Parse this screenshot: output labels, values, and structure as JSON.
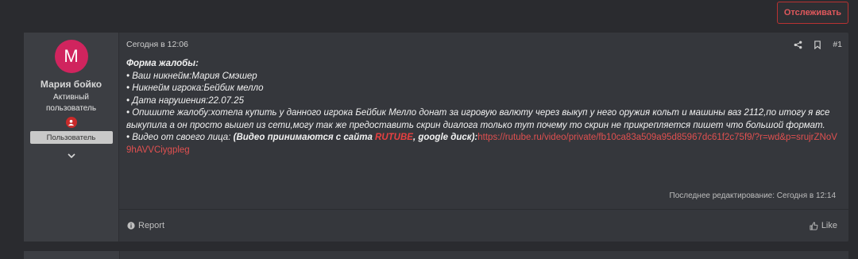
{
  "header": {
    "follow_label": "Отслеживать"
  },
  "user": {
    "avatar_letter": "М",
    "name": "Мария бойко",
    "title": "Активный пользователь",
    "banner": "Пользователь"
  },
  "post": {
    "date": "Сегодня в 12:06",
    "number": "#1",
    "lines": {
      "l1": "Форма жалобы:",
      "l2": "• Ваш никнейм:Мария Смэшер",
      "l3": "• Никнейм игрока:Бейбик мелло",
      "l4": "• Дата нарушения:22.07.25",
      "l5": "• Опишите жалобу:хотела купить у данного игрока Бейбик Мелло донат за игровую валюту через выкуп у него оружия кольт и машины ваз 2112,по итогу я все выкупила а он просто вышел из сети,могу так же предоставить скрин диалога только тут почему то скрин не прикрепляется пишет что большой формат.",
      "l6_prefix": "• Видео от своего лица: ",
      "l6_bold_a": "(Видео принимаются с сайта ",
      "l6_rutube": "RUTUBE",
      "l6_bold_b": ", google диск):",
      "l6_link": "https://rutube.ru/video/private/fb10ca83a509a95d85967dc61f2c75f9/?r=wd&p=srujrZNoV9hAVVCiygpleg"
    },
    "edited": "Последнее редактирование: Сегодня в 12:14",
    "report_label": "Report",
    "like_label": "Like"
  },
  "colors": {
    "accent": "#e05050",
    "avatar": "#d0245e",
    "card": "#35373c",
    "page": "#2a2b2f"
  },
  "icons": {
    "share": "share-icon",
    "bookmark": "bookmark-icon",
    "report": "info-icon",
    "like": "thumbs-up-icon",
    "badge": "user-badge-icon",
    "expand": "chevron-down-icon"
  }
}
